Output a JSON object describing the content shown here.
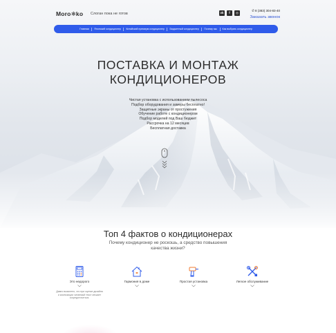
{
  "header": {
    "logo_text": "Moro❄ko",
    "slogan": "Слоган пока не готов",
    "socials": [
      {
        "icon": "vk-icon",
        "label": "vk"
      },
      {
        "icon": "facebook-icon",
        "label": "f"
      },
      {
        "icon": "instagram-icon",
        "label": "◎"
      }
    ],
    "phone": "8 (383) 304-83-40",
    "callback_label": "Заказать звонок"
  },
  "nav": {
    "items": [
      {
        "label": "Главная"
      },
      {
        "label": "Японский кондиционер"
      },
      {
        "label": "Китайский премиум кондиционер"
      },
      {
        "label": "Бюджетный кондиционер"
      },
      {
        "label": "Почему мы"
      },
      {
        "label": "Как выбрать кондиционер"
      }
    ]
  },
  "hero": {
    "title_line1": "ПОСТАВКА И МОНТАЖ",
    "title_line2": "КОНДИЦИОНЕРОВ",
    "features": [
      "Чистая установка с использованием пылесоса",
      "Подбор оборудования и замеры бесплатно!",
      "Защитные экраны от простужения",
      "Обучение работе с кондиционером",
      "Подбор моделей под Ваш бюджет",
      "Рассрочка на 12 месяцев",
      "Бесплатная доставка"
    ]
  },
  "facts": {
    "title": "Топ 4 фактов о кондиционерах",
    "subtitle": "Почему кондиционер не роскошь, а средство повышения качества жизни?",
    "cards": [
      {
        "label": "Это недорого",
        "icon": "calculator-icon",
        "description": "Давно выяснено, что при оценке дизайна и композиции читаемый текст мешает сосредоточиться."
      },
      {
        "label": "Гармония в доме",
        "icon": "house-icon"
      },
      {
        "label": "Простая установка",
        "icon": "drill-icon"
      },
      {
        "label": "Легкое обслуживание",
        "icon": "tools-icon"
      }
    ]
  },
  "colors": {
    "accent": "#2f5bea",
    "link": "#2f55d4"
  }
}
